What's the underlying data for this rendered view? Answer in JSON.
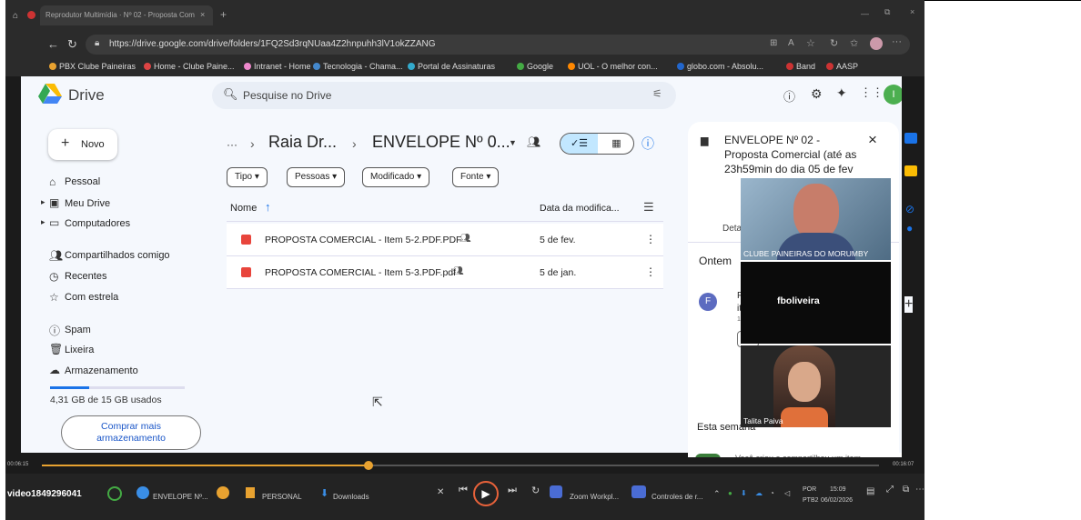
{
  "browser": {
    "tab_title": "Reprodutor Multimídia · Nº 02 - Proposta Com",
    "url": "https://drive.google.com/drive/folders/1FQ2Sd3rqNUaa4Z2hnpuhh3lV1okZZANG",
    "bookmarks": [
      "PBX Clube Paineiras",
      "Home - Clube Paine...",
      "Intranet - Home",
      "Tecnologia - Chama...",
      "Portal de Assinaturas",
      "Google",
      "UOL - O melhor con...",
      "globo.com - Absolu...",
      "Band",
      "AASP"
    ]
  },
  "drive": {
    "app_name": "Drive",
    "search_placeholder": "Pesquise no Drive",
    "avatar_letter": "I",
    "new_button": "Novo",
    "nav": [
      {
        "label": "Pessoal",
        "icon": "home-icon"
      },
      {
        "label": "Meu Drive",
        "icon": "drive-icon"
      },
      {
        "label": "Computadores",
        "icon": "computer-icon"
      },
      {
        "label": "Compartilhados comigo",
        "icon": "shared-icon"
      },
      {
        "label": "Recentes",
        "icon": "clock-icon"
      },
      {
        "label": "Com estrela",
        "icon": "star-icon"
      },
      {
        "label": "Spam",
        "icon": "spam-icon"
      },
      {
        "label": "Lixeira",
        "icon": "trash-icon"
      },
      {
        "label": "Armazenamento",
        "icon": "cloud-icon"
      }
    ],
    "storage_text": "4,31 GB de 15 GB usados",
    "storage_fraction": 0.29,
    "buy_storage": "Comprar mais armazenamento",
    "breadcrumb": {
      "ellipsis": "···",
      "parent": "Raia Dr...",
      "current": "ENVELOPE Nº 0..."
    },
    "filters": [
      "Tipo",
      "Pessoas",
      "Modificado",
      "Fonte"
    ],
    "columns": {
      "name": "Nome",
      "date": "Data da modifica..."
    },
    "files": [
      {
        "name": "PROPOSTA COMERCIAL - Item 5-2.PDF.PDF",
        "date": "5 de fev."
      },
      {
        "name": "PROPOSTA COMERCIAL - Item 5-3.PDF.pdf",
        "date": "5 de jan."
      }
    ],
    "details": {
      "title": "ENVELOPE Nº 02 - Proposta Comercial (até as 23h59min do dia 05 de fev",
      "tab": "Detall",
      "section_today": "Ontem",
      "activity_letter": "F",
      "activity_snip1": "Fe",
      "activity_snip2": "ite",
      "activity_snip3": "15",
      "section_week": "Esta semana",
      "bottom_text": "Você criou e compartilhou um item"
    }
  },
  "meeting": {
    "tiles": [
      {
        "label": "CLUBE PAINEIRAS DO MORUMBY"
      },
      {
        "label": "fboliveira"
      },
      {
        "label": "Talita Paiva"
      }
    ]
  },
  "player": {
    "elapsed": "00:06:15",
    "total": "00:16:07",
    "progress": 0.39
  },
  "taskbar": {
    "video_label": "video1849296041",
    "items": [
      "ENVELOPE Nº...",
      "PERSONAL",
      "Downloads",
      "Zoom Workpl...",
      "Controles de r..."
    ],
    "lang": "POR",
    "lang2": "PTB2",
    "time": "15:09",
    "date": "06/02/2026"
  }
}
